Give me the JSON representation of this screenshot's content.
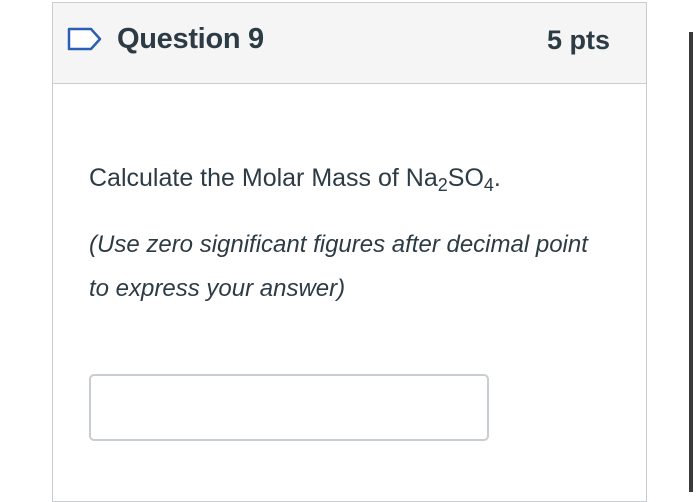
{
  "question": {
    "title": "Question 9",
    "points": "5 pts",
    "flag_icon": "flag-outline-icon",
    "prompt_text": "Calculate the Molar Mass of Na",
    "formula_sub1": "2",
    "formula_mid": "SO",
    "formula_sub2": "4",
    "formula_end": ".",
    "instruction": "(Use zero significant figures after decimal point to express your answer)",
    "answer_value": ""
  },
  "colors": {
    "header_bg": "#f5f5f5",
    "border": "#c7cdd1",
    "text": "#2d3b45",
    "flag": "#2b5fb5"
  }
}
